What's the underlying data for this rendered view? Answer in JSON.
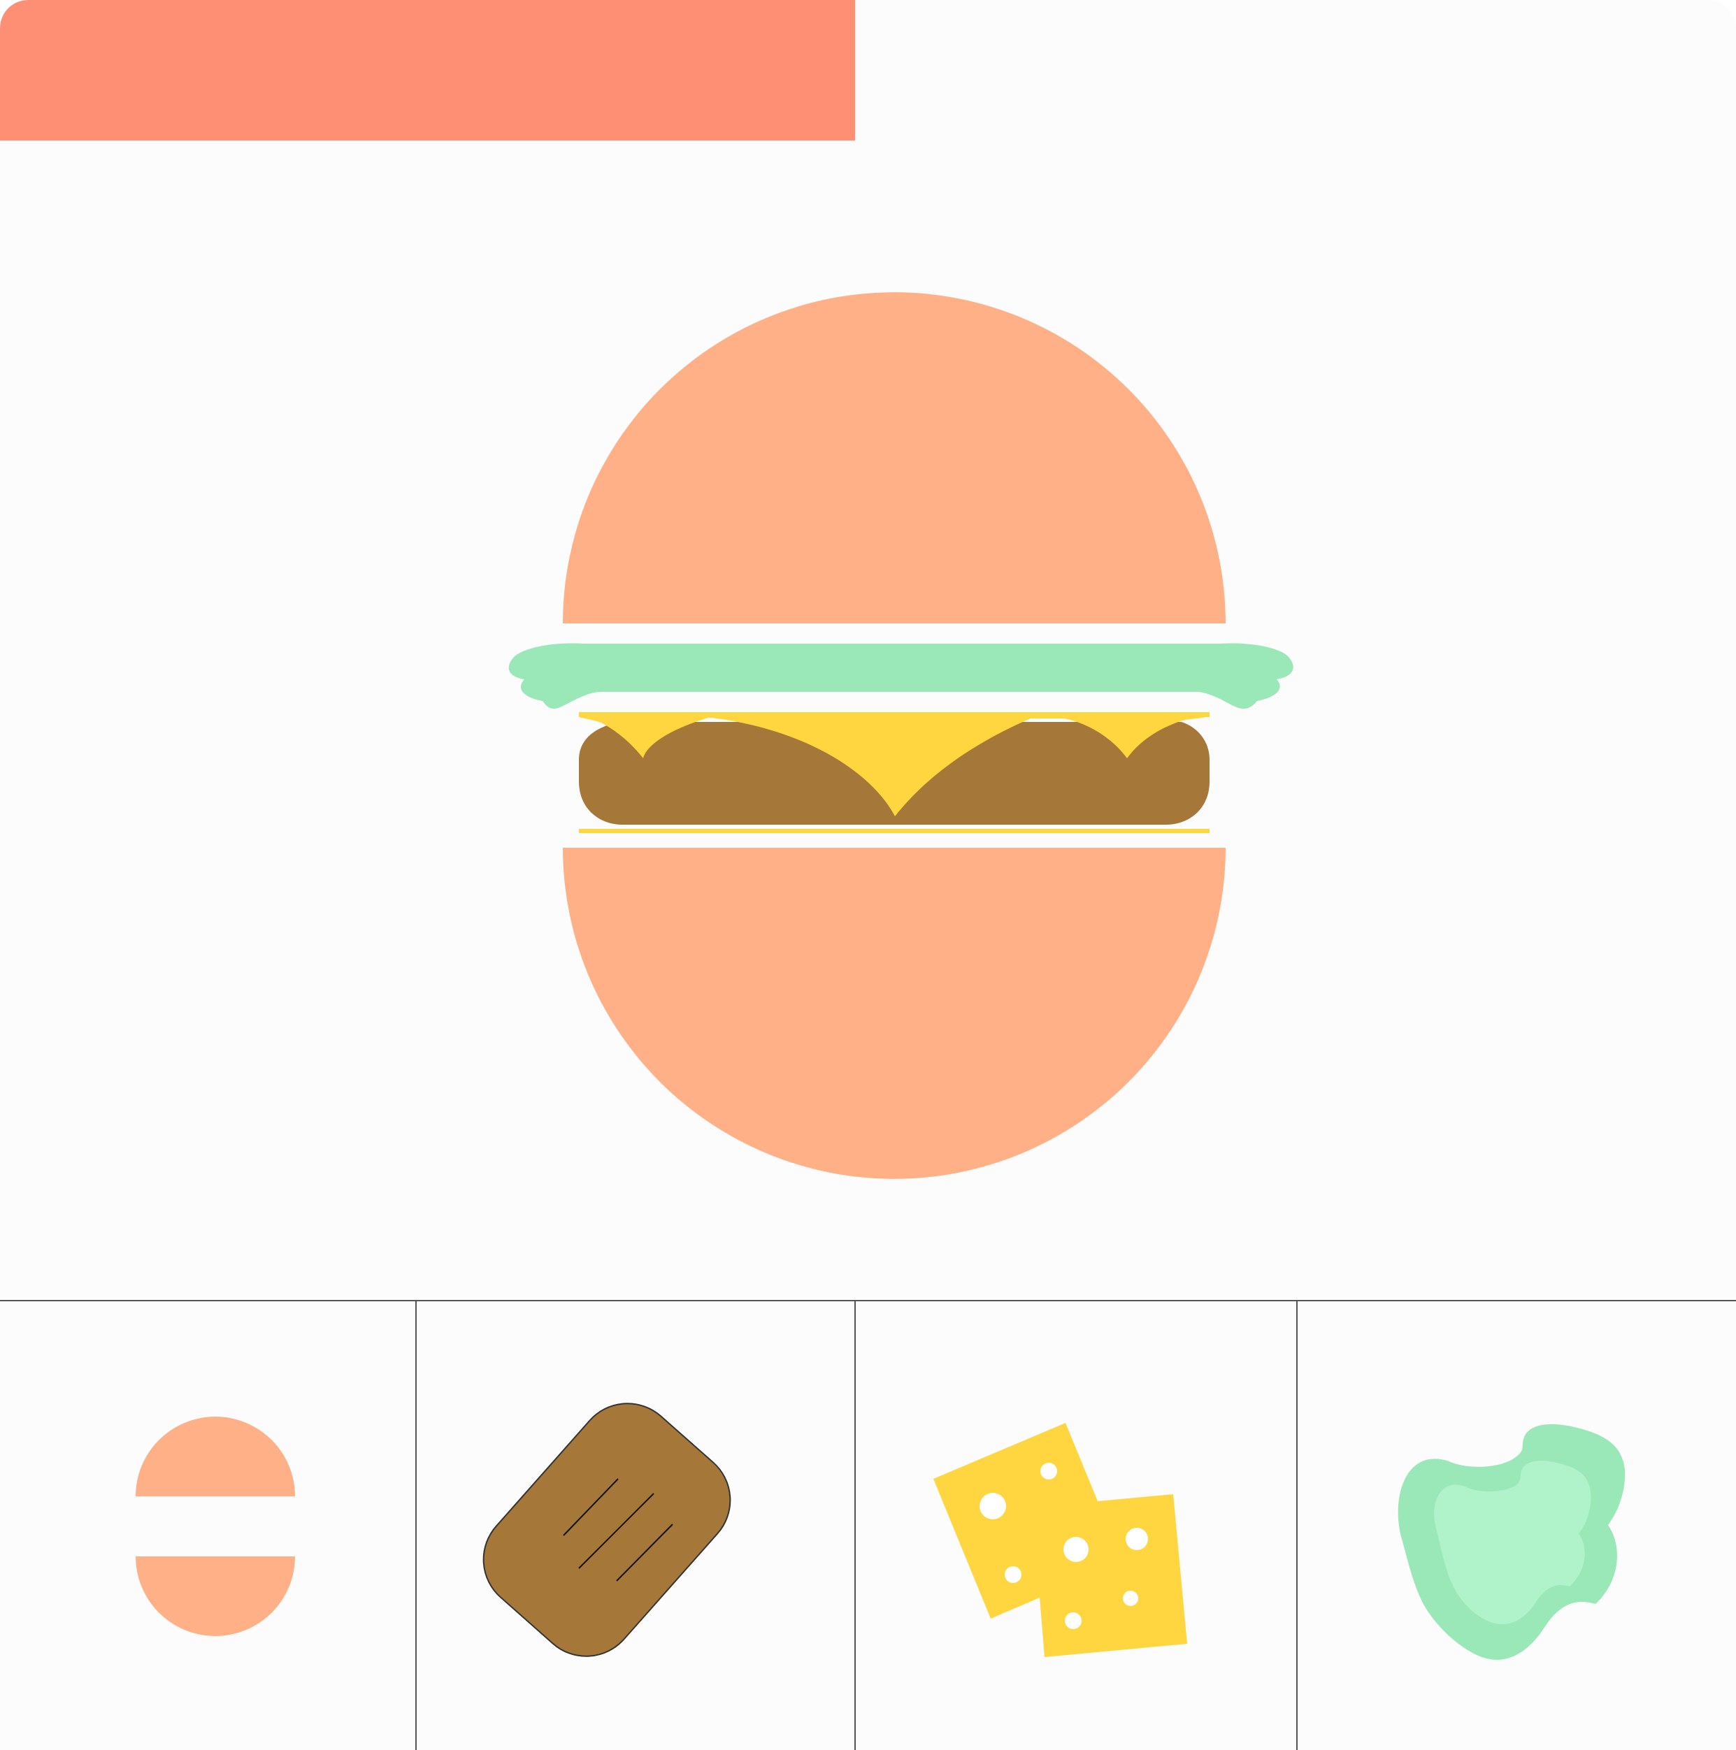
{
  "colors": {
    "background": "#fcfcfc",
    "header_bar": "#ff8f74",
    "bun": "#ffb086",
    "lettuce": "#9ae8b8",
    "lettuce_light": "#b0f2c9",
    "cheese": "#ffd640",
    "patty": "#a57839",
    "divider": "#555555"
  },
  "burger": {
    "layers": [
      "bun-top",
      "lettuce",
      "cheese",
      "patty",
      "cheese",
      "bun-bottom"
    ]
  },
  "tray": {
    "items": [
      {
        "name": "bun",
        "icon": "bun-icon"
      },
      {
        "name": "patty",
        "icon": "patty-icon"
      },
      {
        "name": "cheese",
        "icon": "cheese-icon"
      },
      {
        "name": "lettuce",
        "icon": "lettuce-icon"
      }
    ]
  }
}
